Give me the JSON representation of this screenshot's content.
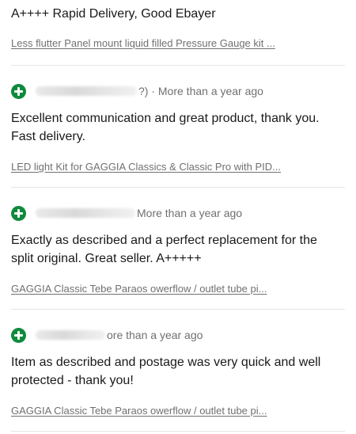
{
  "reviews": [
    {
      "comment": "A++++ Rapid Delivery, Good Ebayer",
      "item": "Less flutter Panel mount liquid filled Pressure Gauge kit ..."
    },
    {
      "meta": "?) · More than a year ago",
      "comment": "Excellent communication and great product, thank you. Fast delivery.",
      "item": "LED light Kit for GAGGIA Classics & Classic Pro with PID..."
    },
    {
      "meta": "More than a year ago",
      "comment": "Exactly as described and a perfect replacement for the split original. Great seller. A+++++",
      "item": "GAGGIA Classic Tebe Paraos owerflow / outlet tube pi..."
    },
    {
      "meta": "ore than a year ago",
      "comment": "Item as described and postage was very quick and well protected - thank you!",
      "item": "GAGGIA Classic Tebe Paraos owerflow / outlet tube pi..."
    }
  ],
  "icons": {
    "rating": "positive-plus-icon"
  },
  "colors": {
    "positive": "#0f8a3d",
    "text": "#191919",
    "secondary": "#707070",
    "divider": "#e5e5e5"
  }
}
